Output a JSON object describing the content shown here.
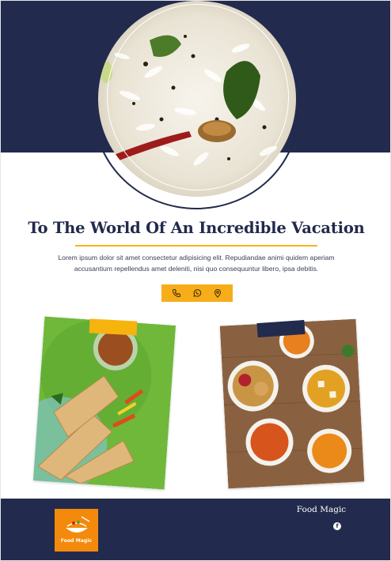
{
  "hero": {
    "headline": "To The World Of An Incredible Vacation",
    "body": "Lorem ipsum dolor sit amet consectetur adipisicing elit. Repudiandae animi quidem aperiam accusantium repellendus amet deleniti, nisi quo consequuntur libero, ipsa debitis."
  },
  "contact": {
    "icons": [
      "phone-icon",
      "whatsapp-icon",
      "location-pin-icon"
    ]
  },
  "footer": {
    "logo_text": "Food Magic",
    "brand_name": "Food Magic",
    "social_icon": "facebook-icon",
    "facebook_glyph": "f"
  },
  "colors": {
    "navy": "#222a4d",
    "accent_yellow": "#f7ad19",
    "logo_orange": "#f48a0c"
  }
}
